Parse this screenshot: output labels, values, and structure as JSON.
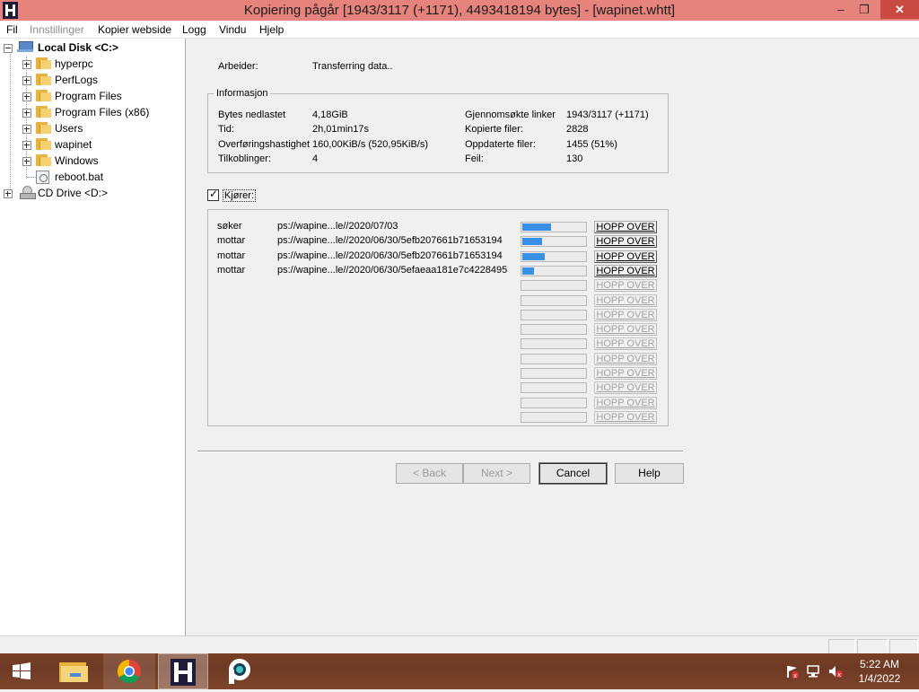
{
  "window": {
    "title": "Kopiering pågår [1943/3117 (+1171), 4493418194 bytes] - [wapinet.whtt]",
    "minimize_glyph": "–",
    "restore_glyph": "❐",
    "close_glyph": "✕"
  },
  "menu": {
    "items": [
      "Fil",
      "Innstillinger",
      "Kopier webside",
      "Logg",
      "Vindu",
      "Hjelp"
    ]
  },
  "tree": {
    "drive_c": "Local Disk <C:>",
    "folders": [
      "hyperpc",
      "PerfLogs",
      "Program Files",
      "Program Files (x86)",
      "Users",
      "wapinet",
      "Windows"
    ],
    "file": "reboot.bat",
    "drive_d": "CD Drive <D:>"
  },
  "status": {
    "worker_label": "Arbeider:",
    "worker_value": "Transferring data.."
  },
  "info": {
    "title": "Informasjon",
    "bytes_label": "Bytes nedlastet",
    "bytes_value": "4,18GiB",
    "time_label": "Tid:",
    "time_value": "2h,01min17s",
    "speed_label": "Overføringshastighet",
    "speed_value": "160,00KiB/s (520,95KiB/s)",
    "connections_label": "Tilkoblinger:",
    "connections_value": "4",
    "links_label": "Gjennomsøkte linker",
    "links_value": "1943/3117 (+1171)",
    "copied_label": "Kopierte filer:",
    "copied_value": "2828",
    "updated_label": "Oppdaterte filer:",
    "updated_value": "1455 (51%)",
    "errors_label": "Feil:",
    "errors_value": "130"
  },
  "running": {
    "label": "Kjører:",
    "checked": "✓"
  },
  "transfers": {
    "skip_label": "HOPP OVER",
    "rows": [
      {
        "action": "søker",
        "url": "ps://wapine...le//2020/07/03",
        "progress": 0.45
      },
      {
        "action": "mottar",
        "url": "ps://wapine...le//2020/06/30/5efb207661b71653194",
        "progress": 0.32
      },
      {
        "action": "mottar",
        "url": "ps://wapine...le//2020/06/30/5efb207661b71653194",
        "progress": 0.35
      },
      {
        "action": "mottar",
        "url": "ps://wapine...le//2020/06/30/5efaeaa181e7c4228495",
        "progress": 0.18
      }
    ],
    "idle_slots": 10
  },
  "buttons": {
    "back": "< Back",
    "next": "Next >",
    "cancel": "Cancel",
    "help": "Help"
  },
  "clock": {
    "time": "5:22 AM",
    "date": "1/4/2022"
  },
  "colors": {
    "titlebar": "#e6837d",
    "progress": "#3a8ee6",
    "close": "#c94a43"
  }
}
